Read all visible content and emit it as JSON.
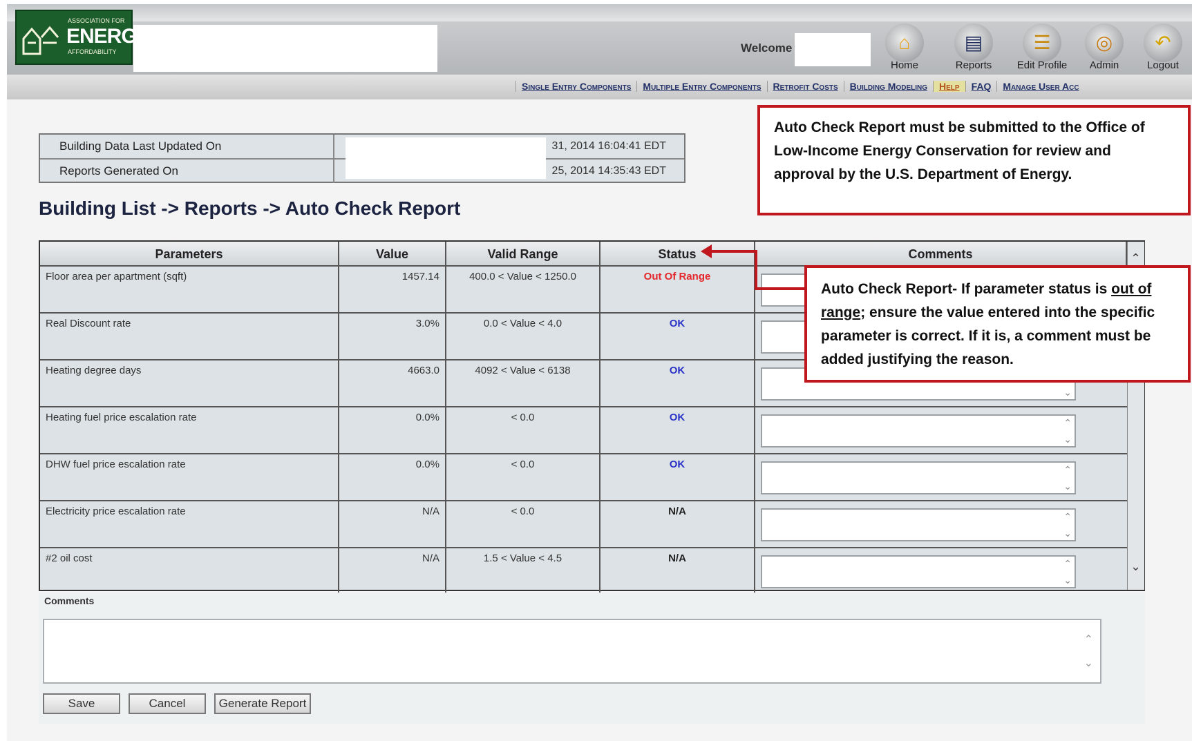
{
  "header": {
    "logo": {
      "assoc_text": "ASSOCIATION FOR",
      "energy_text": "ENERGY",
      "afford_text": "AFFORDABILITY"
    },
    "welcome_label": "Welcome",
    "nav": [
      {
        "label": "Home",
        "icon": "house-icon"
      },
      {
        "label": "Reports",
        "icon": "reports-icon"
      },
      {
        "label": "Edit Profile",
        "icon": "edit-profile-icon"
      },
      {
        "label": "Admin",
        "icon": "admin-icon"
      },
      {
        "label": "Logout",
        "icon": "logout-icon"
      }
    ]
  },
  "subnav": [
    "Single Entry Components",
    "Multiple Entry Components",
    "Retrofit Costs",
    "Building Modeling",
    "Help",
    "FAQ",
    "Manage User Acc"
  ],
  "info": {
    "rows": [
      {
        "label": "Building Data Last Updated On",
        "value": "31, 2014 16:04:41 EDT"
      },
      {
        "label": "Reports Generated On",
        "value": "25, 2014 14:35:43 EDT"
      }
    ]
  },
  "breadcrumb": "Building List -> Reports -> Auto Check Report",
  "table": {
    "headers": [
      "Parameters",
      "Value",
      "Valid Range",
      "Status",
      "Comments"
    ],
    "rows": [
      {
        "param": "Floor area per apartment (sqft)",
        "value": "1457.14",
        "range": "400.0 < Value < 1250.0",
        "status": "Out Of Range",
        "status_type": "bad"
      },
      {
        "param": "Real Discount rate",
        "value": "3.0%",
        "range": "0.0 < Value < 4.0",
        "status": "OK",
        "status_type": "ok"
      },
      {
        "param": "Heating degree days",
        "value": "4663.0",
        "range": "4092 < Value < 6138",
        "status": "OK",
        "status_type": "ok"
      },
      {
        "param": "Heating fuel price escalation rate",
        "value": "0.0%",
        "range": "< 0.0",
        "status": "OK",
        "status_type": "ok"
      },
      {
        "param": "DHW fuel price escalation rate",
        "value": "0.0%",
        "range": "< 0.0",
        "status": "OK",
        "status_type": "ok"
      },
      {
        "param": "Electricity price escalation rate",
        "value": "N/A",
        "range": "< 0.0",
        "status": "N/A",
        "status_type": "na"
      },
      {
        "param": "#2 oil cost",
        "value": "N/A",
        "range": "1.5 < Value < 4.5",
        "status": "N/A",
        "status_type": "na"
      }
    ]
  },
  "comments_label": "Comments",
  "buttons": {
    "save": "Save",
    "cancel": "Cancel",
    "generate": "Generate Report"
  },
  "callouts": {
    "submit_note": "Auto Check Report must be submitted to the Office of Low-Income Energy Conservation for review and approval by the U.S. Department of Energy.",
    "range_note_pre": "Auto Check Report- If parameter status is ",
    "range_note_underline": "out of range",
    "range_note_post": "; ensure the value entered into the specific parameter is correct.  If it is, a comment must be added justifying the reason."
  },
  "colors": {
    "out_of_range": "#e5262b",
    "ok": "#2a32c8",
    "callout_border": "#c0171e",
    "logo_green": "#1b5e2b"
  }
}
